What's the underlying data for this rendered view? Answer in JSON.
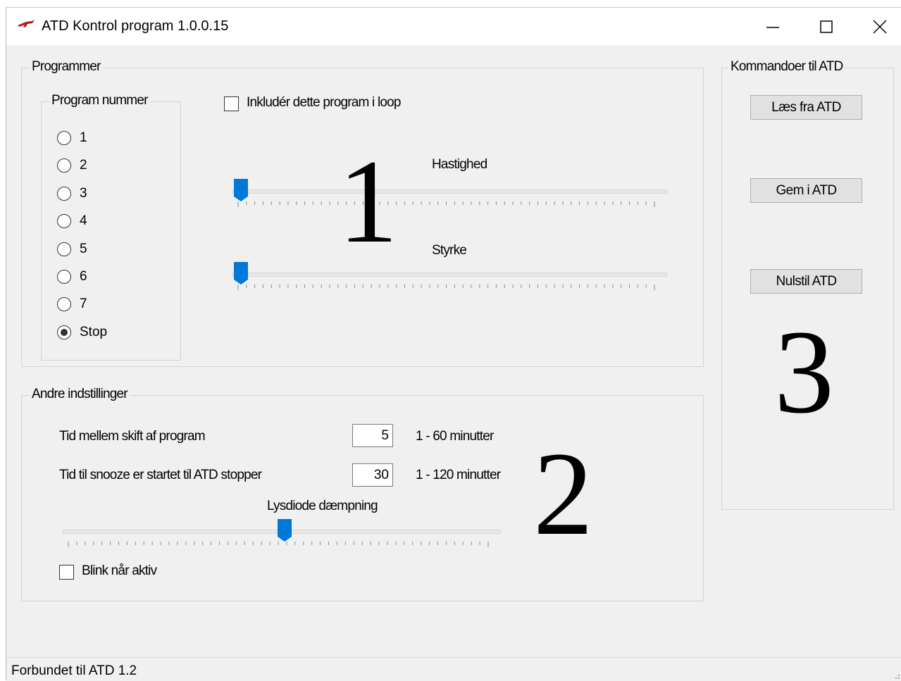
{
  "window": {
    "title": "ATD Kontrol program 1.0.0.15",
    "controls": [
      "minimize",
      "maximize",
      "close"
    ]
  },
  "programmer": {
    "legend": "Programmer",
    "program_group": {
      "legend": "Program nummer",
      "options": [
        "1",
        "2",
        "3",
        "4",
        "5",
        "6",
        "7",
        "Stop"
      ],
      "selected": "Stop"
    },
    "loop_checkbox": {
      "label": "Inkludér dette program i loop",
      "checked": false
    },
    "hastighed": {
      "label": "Hastighed",
      "value_fraction": 0.0
    },
    "styrke": {
      "label": "Styrke",
      "value_fraction": 0.0
    },
    "marker": "1"
  },
  "andre": {
    "legend": "Andre indstillinger",
    "skift": {
      "label": "Tid mellem skift af program",
      "value": "5",
      "range": "1 - 60 minutter"
    },
    "snooze": {
      "label": "Tid til snooze er startet til ATD stopper",
      "value": "30",
      "range": "1 - 120 minutter"
    },
    "lysdiode": {
      "label": "Lysdiode dæmpning",
      "value_fraction": 0.52
    },
    "blink": {
      "label": "Blink når aktiv",
      "checked": false
    },
    "marker": "2"
  },
  "kommandoer": {
    "legend": "Kommandoer til ATD",
    "buttons": [
      "Læs fra ATD",
      "Gem i ATD",
      "Nulstil ATD"
    ],
    "marker": "3"
  },
  "status": {
    "text": "Forbundet til ATD  1.2"
  },
  "colors": {
    "slider_thumb": "#0078d7",
    "window_bg": "#f0f0f0",
    "titlebar_bg": "#ffffff"
  }
}
